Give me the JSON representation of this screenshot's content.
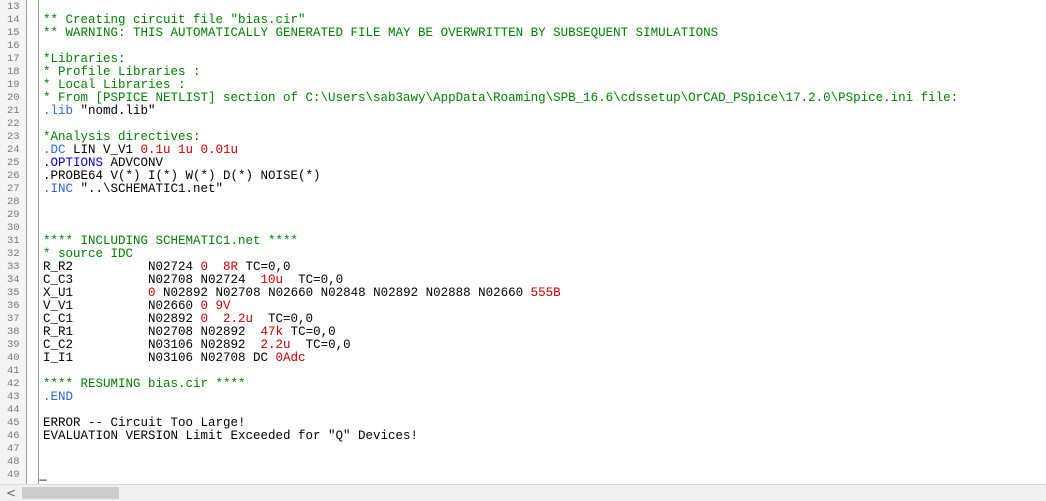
{
  "colors": {
    "default": "#000000",
    "comment": "#008000",
    "keyword": "#0000cc",
    "dotcmd": "#2a6bd6",
    "number": "#cc0000",
    "gutter_text": "#7a7a7a"
  },
  "editor": {
    "lines": [
      {
        "num": "13",
        "segments": []
      },
      {
        "num": "14",
        "segments": [
          {
            "t": "** Creating circuit file \"bias.cir\"",
            "c": "comment"
          }
        ]
      },
      {
        "num": "15",
        "segments": [
          {
            "t": "** WARNING: THIS AUTOMATICALLY GENERATED FILE MAY BE OVERWRITTEN BY SUBSEQUENT SIMULATIONS",
            "c": "comment"
          }
        ]
      },
      {
        "num": "16",
        "segments": []
      },
      {
        "num": "17",
        "segments": [
          {
            "t": "*Libraries:",
            "c": "comment"
          }
        ]
      },
      {
        "num": "18",
        "segments": [
          {
            "t": "* Profile Libraries :",
            "c": "comment"
          }
        ]
      },
      {
        "num": "19",
        "segments": [
          {
            "t": "* Local Libraries :",
            "c": "comment"
          }
        ]
      },
      {
        "num": "20",
        "segments": [
          {
            "t": "* From [PSPICE NETLIST] section of C:\\Users\\sab3awy\\AppData\\Roaming\\SPB_16.6\\cdssetup\\OrCAD_PSpice\\17.2.0\\PSpice.ini file:",
            "c": "comment"
          }
        ]
      },
      {
        "num": "21",
        "segments": [
          {
            "t": ".lib",
            "c": "dotcmd"
          },
          {
            "t": " \"nomd.lib\"",
            "c": "default"
          }
        ]
      },
      {
        "num": "22",
        "segments": []
      },
      {
        "num": "23",
        "segments": [
          {
            "t": "*Analysis directives:",
            "c": "comment"
          }
        ]
      },
      {
        "num": "24",
        "segments": [
          {
            "t": ".DC",
            "c": "dotcmd"
          },
          {
            "t": " LIN V_V1 ",
            "c": "default"
          },
          {
            "t": "0.1u 1u 0.01u",
            "c": "number"
          }
        ]
      },
      {
        "num": "25",
        "segments": [
          {
            "t": ".OPTIONS",
            "c": "keyword"
          },
          {
            "t": " ADVCONV",
            "c": "default"
          }
        ]
      },
      {
        "num": "26",
        "segments": [
          {
            "t": ".PROBE64 V(*) I(*) W(*) D(*) NOISE(*)",
            "c": "default"
          }
        ]
      },
      {
        "num": "27",
        "segments": [
          {
            "t": ".INC",
            "c": "dotcmd"
          },
          {
            "t": " \"..\\SCHEMATIC1.net\"",
            "c": "default"
          }
        ]
      },
      {
        "num": "28",
        "segments": []
      },
      {
        "num": "29",
        "segments": []
      },
      {
        "num": "30",
        "segments": []
      },
      {
        "num": "31",
        "segments": [
          {
            "t": "**** INCLUDING SCHEMATIC1.net ****",
            "c": "comment"
          }
        ]
      },
      {
        "num": "32",
        "segments": [
          {
            "t": "* source IDC",
            "c": "comment"
          }
        ]
      },
      {
        "num": "33",
        "segments": [
          {
            "t": "R_R2          N02724 ",
            "c": "default"
          },
          {
            "t": "0  8R",
            "c": "number"
          },
          {
            "t": " TC=0,0",
            "c": "default"
          }
        ]
      },
      {
        "num": "34",
        "segments": [
          {
            "t": "C_C3          N02708 N02724  ",
            "c": "default"
          },
          {
            "t": "10u",
            "c": "number"
          },
          {
            "t": "  TC=0,0",
            "c": "default"
          }
        ]
      },
      {
        "num": "35",
        "segments": [
          {
            "t": "X_U1          ",
            "c": "default"
          },
          {
            "t": "0",
            "c": "number"
          },
          {
            "t": " N02892 N02708 N02660 N02848 N02892 N02888 N02660 ",
            "c": "default"
          },
          {
            "t": "555B",
            "c": "number"
          }
        ]
      },
      {
        "num": "36",
        "segments": [
          {
            "t": "V_V1          N02660 ",
            "c": "default"
          },
          {
            "t": "0 9V",
            "c": "number"
          }
        ]
      },
      {
        "num": "37",
        "segments": [
          {
            "t": "C_C1          N02892 ",
            "c": "default"
          },
          {
            "t": "0  2.2u",
            "c": "number"
          },
          {
            "t": "  TC=0,0",
            "c": "default"
          }
        ]
      },
      {
        "num": "38",
        "segments": [
          {
            "t": "R_R1          N02708 N02892  ",
            "c": "default"
          },
          {
            "t": "47k",
            "c": "number"
          },
          {
            "t": " TC=0,0",
            "c": "default"
          }
        ]
      },
      {
        "num": "39",
        "segments": [
          {
            "t": "C_C2          N03106 N02892  ",
            "c": "default"
          },
          {
            "t": "2.2u",
            "c": "number"
          },
          {
            "t": "  TC=0,0",
            "c": "default"
          }
        ]
      },
      {
        "num": "40",
        "segments": [
          {
            "t": "I_I1          N03106 N02708 DC ",
            "c": "default"
          },
          {
            "t": "0Adc",
            "c": "number"
          }
        ]
      },
      {
        "num": "41",
        "segments": []
      },
      {
        "num": "42",
        "segments": [
          {
            "t": "**** RESUMING bias.cir ****",
            "c": "comment"
          }
        ]
      },
      {
        "num": "43",
        "segments": [
          {
            "t": ".END",
            "c": "dotcmd"
          }
        ]
      },
      {
        "num": "44",
        "segments": []
      },
      {
        "num": "45",
        "segments": [
          {
            "t": "ERROR -- Circuit Too Large!",
            "c": "default"
          }
        ]
      },
      {
        "num": "46",
        "segments": [
          {
            "t": "EVALUATION VERSION Limit Exceeded for \"Q\" Devices!",
            "c": "default"
          }
        ]
      },
      {
        "num": "47",
        "segments": []
      },
      {
        "num": "48",
        "segments": []
      },
      {
        "num": "49",
        "segments": [
          {
            "t": "̲",
            "c": "default"
          }
        ]
      }
    ]
  },
  "scrollbar": {
    "left_arrow_icon": "chevron-left-icon",
    "left_arrow_glyph": "<"
  }
}
